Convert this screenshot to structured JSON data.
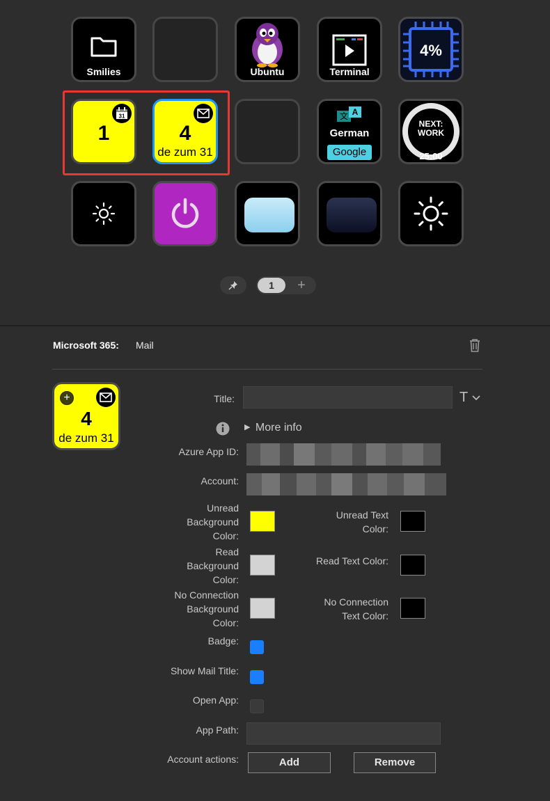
{
  "keys": {
    "smilies": "Smilies",
    "ubuntu": "Ubuntu",
    "terminal": "Terminal",
    "cpu": "4%",
    "calendar_count": "1",
    "calendar_badge_day": "31",
    "mail_count": "4",
    "mail_subtitle": "de zum 31",
    "translate_language": "German",
    "translate_service": "Google",
    "translate_glyph_a": "文",
    "translate_glyph_b": "A",
    "timer_title": "NEXT:\nWORK",
    "timer_title_line1": "NEXT:",
    "timer_title_line2": "WORK",
    "timer_time": "25:00"
  },
  "pager": {
    "current_page": "1",
    "add": "+"
  },
  "inspector": {
    "plugin": "Microsoft 365:",
    "action": "Mail",
    "preview": {
      "count": "4",
      "subtitle": "de zum 31",
      "add_glyph": "+"
    },
    "title_label": "Title:",
    "title_value": "",
    "title_font_glyph": "T",
    "more_info": "More info",
    "azure_label": "Azure App ID:",
    "account_label": "Account:",
    "unread_bg_label": "Unread Background Color:",
    "unread_bg_l1": "Unread",
    "unread_bg_l2": "Background",
    "unread_bg_l3": "Color:",
    "unread_text_l1": "Unread Text",
    "unread_text_l2": "Color:",
    "read_bg_l1": "Read",
    "read_bg_l2": "Background",
    "read_bg_l3": "Color:",
    "read_text_label": "Read Text Color:",
    "noconn_bg_l1": "No Connection",
    "noconn_bg_l2": "Background",
    "noconn_bg_l3": "Color:",
    "noconn_text_l1": "No Connection",
    "noconn_text_l2": "Text Color:",
    "badge_label": "Badge:",
    "badge_checked": true,
    "show_mail_title_label": "Show Mail Title:",
    "show_mail_title_checked": true,
    "open_app_label": "Open App:",
    "open_app_checked": false,
    "app_path_label": "App Path:",
    "app_path_value": "",
    "account_actions_label": "Account actions:",
    "add_button": "Add",
    "remove_button": "Remove"
  },
  "colors": {
    "unread_bg": "#ffff00",
    "unread_text": "#000000",
    "read_bg": "#d3d3d3",
    "read_text": "#000000",
    "noconn_bg": "#d3d3d3",
    "noconn_text": "#000000",
    "checkbox_on": "#1a7fff",
    "selection_outline": "#e53935",
    "selected_key_border": "#2196f3",
    "power_key": "#b026c0"
  }
}
